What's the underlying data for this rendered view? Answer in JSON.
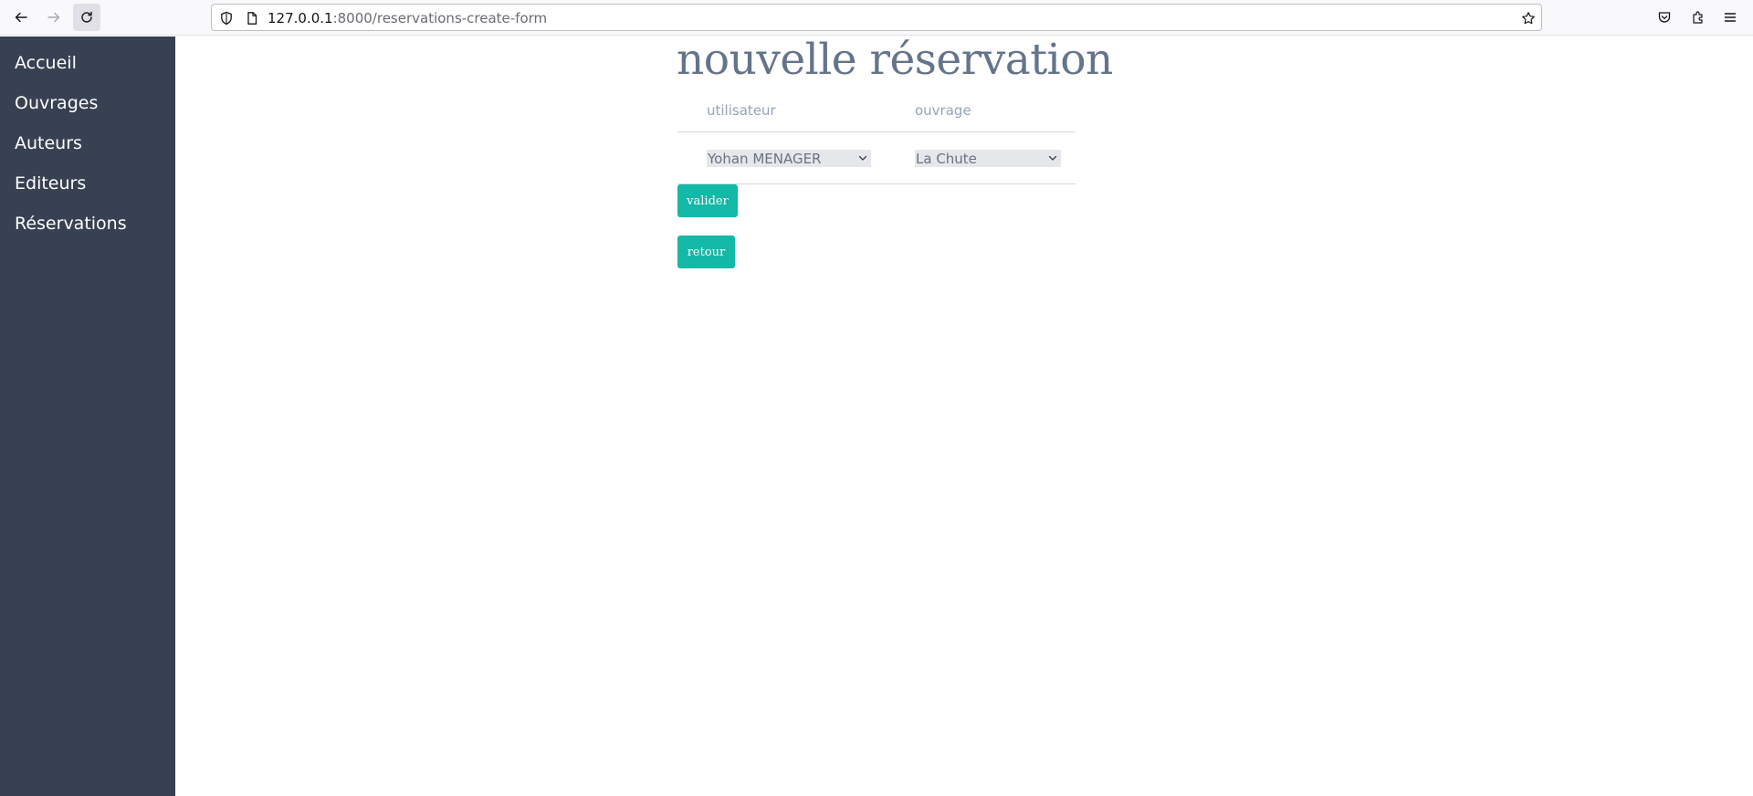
{
  "browser": {
    "url_host": "127.0.0.1",
    "url_rest": ":8000/reservations-create-form"
  },
  "sidebar": {
    "items": [
      {
        "label": "Accueil"
      },
      {
        "label": "Ouvrages"
      },
      {
        "label": "Auteurs"
      },
      {
        "label": "Editeurs"
      },
      {
        "label": "Réservations"
      }
    ]
  },
  "main": {
    "title": "nouvelle réservation",
    "columns": [
      "utilisateur",
      "ouvrage"
    ],
    "utilisateur_selected": "Yohan MENAGER",
    "ouvrage_selected": "La Chute",
    "submit_label": "valider",
    "back_label": "retour"
  },
  "colors": {
    "sidebar_bg": "#374151",
    "accent": "#14b8a6",
    "title": "#64748b"
  }
}
